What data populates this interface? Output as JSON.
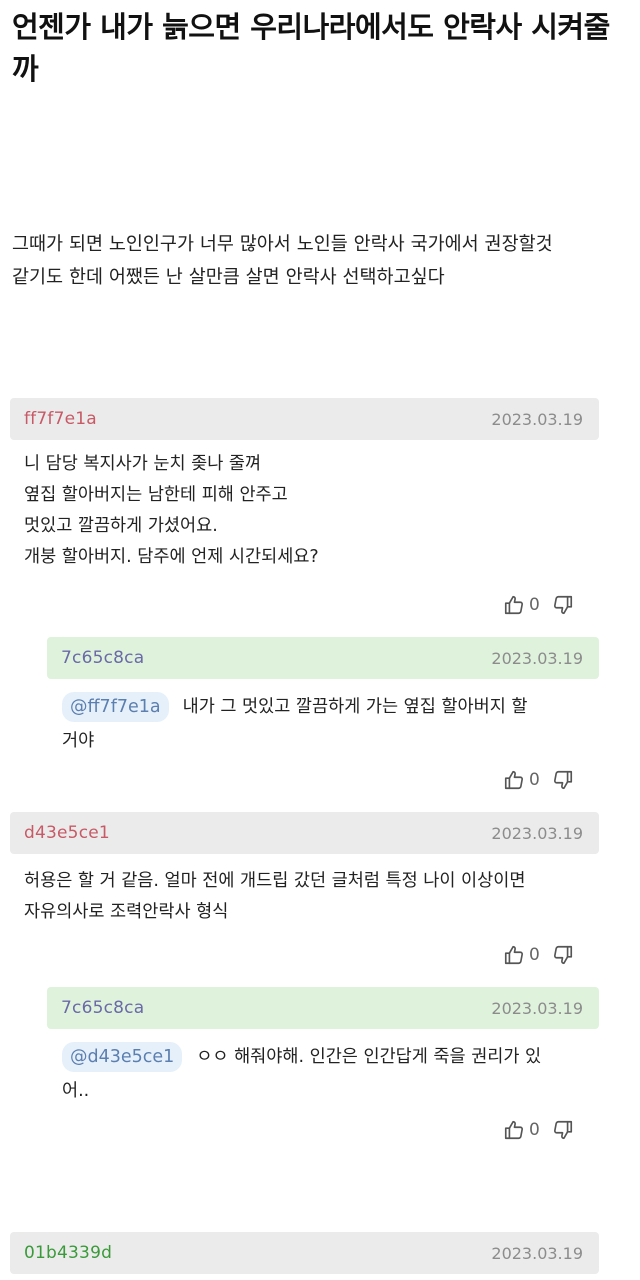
{
  "post": {
    "title": "언젠가 내가 늙으면 우리나라에서도 안락사 시켜줄까",
    "body": "그때가 되면 노인인구가 너무 많아서 노인들 안락사 국가에서 권장할것\n같기도 한데 어쨌든 난 살만큼 살면 안락사 선택하고싶다"
  },
  "colors": {
    "nick_red": "#c75a66",
    "nick_purple": "#6a6aa8",
    "nick_green": "#3a9a3a",
    "header_gray": "#ebebeb",
    "header_green": "#dff2dc",
    "mention_bg": "#e6f0fa"
  },
  "comments": [
    {
      "nick": "ff7f7e1a",
      "date": "2023.03.19",
      "text": "니 담당 복지사가 눈치 좆나 줄껴\n옆집 할아버지는 남한테 피해 안주고\n멋있고 깔끔하게 가셨어요.\n개붕 할아버지. 담주에 언제 시간되세요?",
      "likes": "0",
      "reply": {
        "nick": "7c65c8ca",
        "date": "2023.03.19",
        "mention": "@ff7f7e1a",
        "text_line1": "내가 그 멋있고 깔끔하게 가는 옆집 할아버지 할",
        "text_line2": "거야",
        "likes": "0"
      }
    },
    {
      "nick": "d43e5ce1",
      "date": "2023.03.19",
      "text": "허용은 할 거 같음. 얼마 전에 개드립 갔던 글처럼 특정 나이 이상이면\n자유의사로 조력안락사 형식",
      "likes": "0",
      "reply": {
        "nick": "7c65c8ca",
        "date": "2023.03.19",
        "mention": "@d43e5ce1",
        "text_line1": "ㅇㅇ 해줘야해. 인간은 인간답게 죽을 권리가 있",
        "text_line2": "어..",
        "likes": "0"
      }
    },
    {
      "nick": "01b4339d",
      "date": "2023.03.19"
    }
  ]
}
